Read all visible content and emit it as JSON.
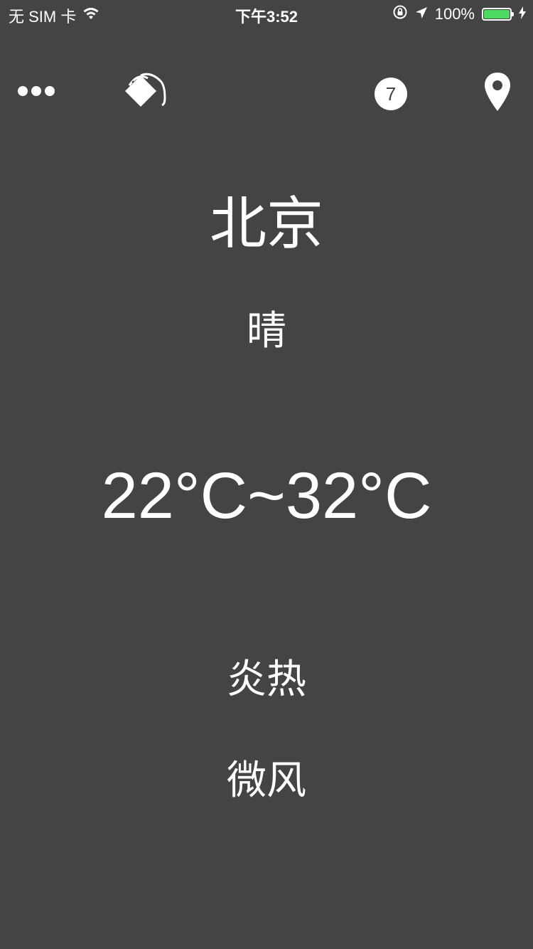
{
  "status_bar": {
    "carrier": "无 SIM 卡",
    "time": "下午3:52",
    "battery_percent": "100%",
    "battery_level": 1.0,
    "battery_color": "#4cd964"
  },
  "toolbar": {
    "more_icon": "more-dots-icon",
    "paint_icon": "paint-bucket-icon",
    "days_count": "7",
    "location_icon": "location-pin-icon"
  },
  "weather": {
    "city": "北京",
    "condition": "晴",
    "temperature_range": "22°C~32°C",
    "feeling": "炎热",
    "wind": "微风"
  },
  "colors": {
    "background": "#444444",
    "text": "#ffffff"
  }
}
